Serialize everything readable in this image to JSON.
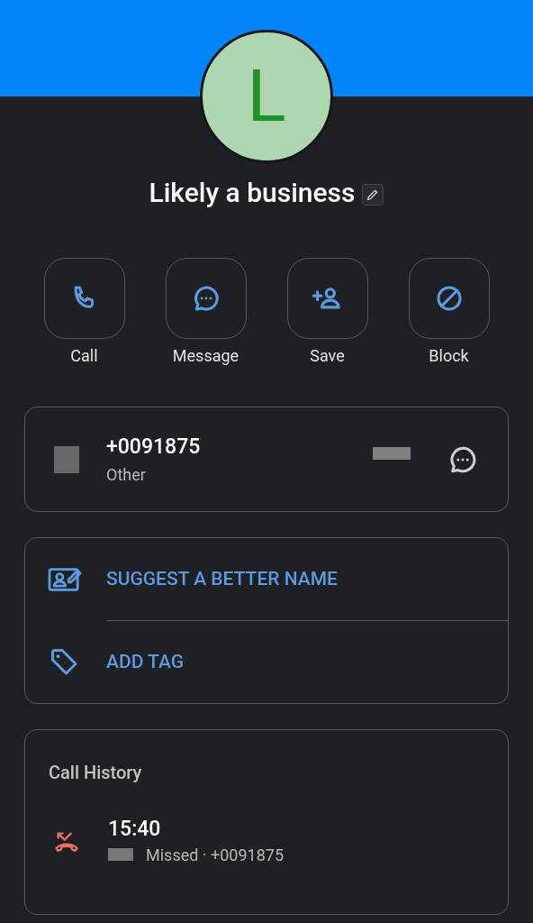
{
  "avatar": {
    "letter": "L"
  },
  "title": "Likely a business",
  "actions": [
    {
      "kind": "call",
      "label": "Call"
    },
    {
      "kind": "message",
      "label": "Message"
    },
    {
      "kind": "save",
      "label": "Save"
    },
    {
      "kind": "block",
      "label": "Block"
    }
  ],
  "number_card": {
    "number": "+0091875",
    "type": "Other"
  },
  "options": [
    {
      "kind": "suggest",
      "label": "SUGGEST A BETTER NAME"
    },
    {
      "kind": "tag",
      "label": "ADD TAG"
    }
  ],
  "call_history": {
    "title": "Call History",
    "entries": [
      {
        "kind": "missed",
        "time": "15:40",
        "detail": "Missed · +0091875"
      }
    ]
  }
}
